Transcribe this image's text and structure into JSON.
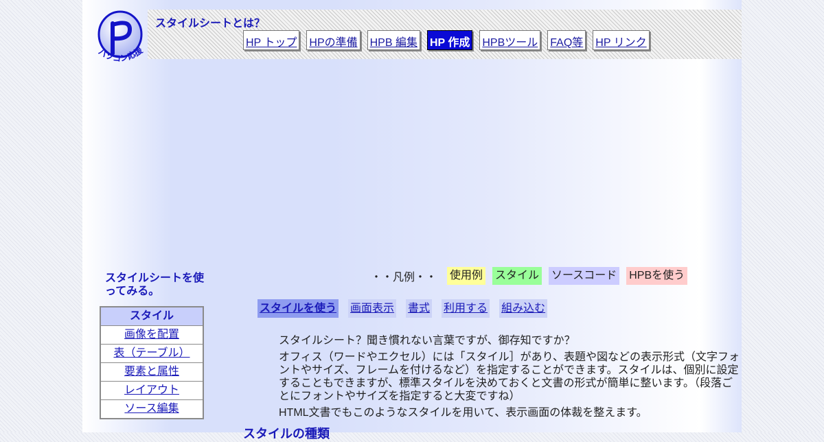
{
  "header": {
    "logo_text": "パソコン応援隊",
    "site_title": "スタイルシートとは？"
  },
  "topnav": [
    {
      "label": "HP トップ",
      "active": false
    },
    {
      "label": "HPの準備",
      "active": false
    },
    {
      "label": "HPB 編集",
      "active": false
    },
    {
      "label": "HP 作成",
      "active": true
    },
    {
      "label": "HPBツール",
      "active": false
    },
    {
      "label": "FAQ等",
      "active": false
    },
    {
      "label": "HP リンク",
      "active": false
    }
  ],
  "sidebar": {
    "title": "スタイルシートを使ってみる。",
    "menu_header": "スタイル",
    "items": [
      {
        "label": "画像を配置"
      },
      {
        "label": "表（テーブル）"
      },
      {
        "label": "要素と属性"
      },
      {
        "label": "レイアウト"
      },
      {
        "label": "ソース編集"
      }
    ]
  },
  "legend": {
    "label": "・・凡例・・",
    "chips": [
      {
        "label": "使用例",
        "color": "#ffff99"
      },
      {
        "label": "スタイル",
        "color": "#99ff99"
      },
      {
        "label": "ソースコード",
        "color": "#ccccff"
      },
      {
        "label": "HPBを使う",
        "color": "#ffcccc"
      }
    ]
  },
  "subnav": [
    {
      "label": "スタイルを使う",
      "active": true
    },
    {
      "label": "画面表示",
      "active": false
    },
    {
      "label": "書式",
      "active": false
    },
    {
      "label": "利用する",
      "active": false
    },
    {
      "label": "組み込む",
      "active": false
    }
  ],
  "content": {
    "paragraphs": [
      "スタイルシート？聞き慣れない言葉ですが、御存知ですか？",
      "オフィス（ワードやエクセル）には「スタイル］があり、表題や図などの表示形式（文字フォントやサイズ、フレームを付けるなど）を指定することができます。スタイルは、個別に設定することもできますが、標準スタイルを決めておくと文書の形式が簡単に整います。（段落ごとにフォントやサイズを指定すると大変ですね）",
      "HTML文書でもこのようなスタイルを用いて、表示画面の体裁を整えます。"
    ],
    "section_title": "スタイルの種類"
  },
  "colors": {
    "accent": "#1a1ab8",
    "nav_active_bg": "#0a0ad6",
    "subnav_bg": "#ccd3f7",
    "subnav_active_bg": "#8e9cf0",
    "side_header_bg": "#c8cffb"
  }
}
